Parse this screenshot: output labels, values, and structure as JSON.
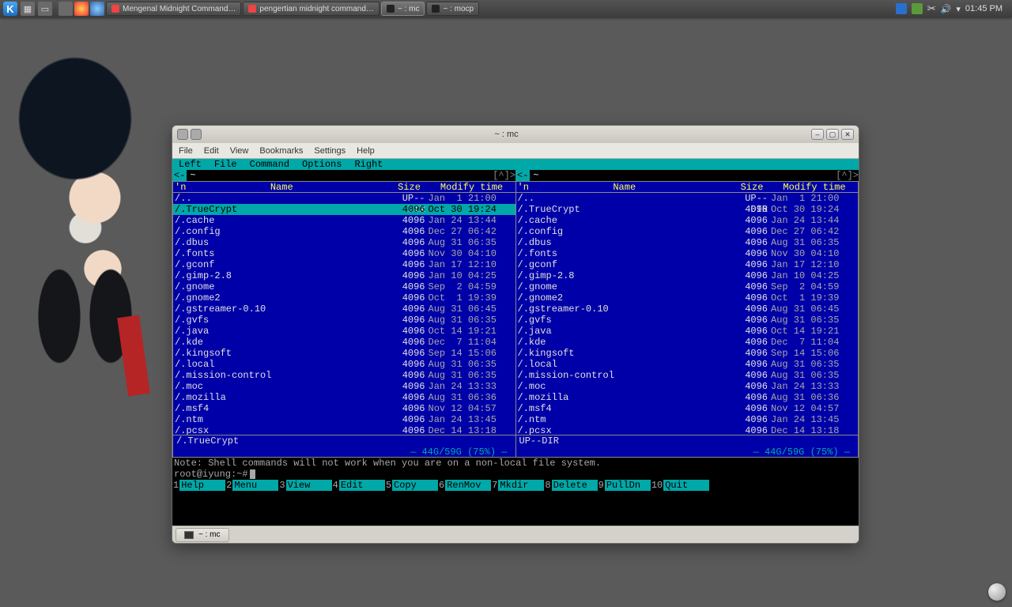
{
  "panel": {
    "tasks": [
      {
        "label": "Mengenal Midnight Command…",
        "icon": "chrome"
      },
      {
        "label": "pengertian midnight command…",
        "icon": "chromium"
      },
      {
        "label": "~ : mc",
        "icon": "terminal",
        "active": true
      },
      {
        "label": "~ : mocp",
        "icon": "terminal"
      }
    ],
    "clock": "01:45 PM"
  },
  "window": {
    "title": "~ : mc",
    "menubar": [
      "File",
      "Edit",
      "View",
      "Bookmarks",
      "Settings",
      "Help"
    ],
    "task_label": "~ : mc"
  },
  "mc": {
    "top_menu": [
      "Left",
      "File",
      "Command",
      "Options",
      "Right"
    ],
    "path_left": "~",
    "path_right": "~",
    "sort_mark": "'n",
    "headers": {
      "name": "Name",
      "size": "Size",
      "mtime": "Modify time"
    },
    "updir_label": "UP--DIR",
    "files": [
      {
        "name": "/..",
        "size": "UP--DIR",
        "mtime": "Jan  1 21:00",
        "updir": true
      },
      {
        "name": "/.TrueCrypt",
        "size": "4096",
        "mtime": "Oct 30 19:24",
        "selected": true
      },
      {
        "name": "/.cache",
        "size": "4096",
        "mtime": "Jan 24 13:44"
      },
      {
        "name": "/.config",
        "size": "4096",
        "mtime": "Dec 27 06:42"
      },
      {
        "name": "/.dbus",
        "size": "4096",
        "mtime": "Aug 31 06:35"
      },
      {
        "name": "/.fonts",
        "size": "4096",
        "mtime": "Nov 30 04:10"
      },
      {
        "name": "/.gconf",
        "size": "4096",
        "mtime": "Jan 17 12:10"
      },
      {
        "name": "/.gimp-2.8",
        "size": "4096",
        "mtime": "Jan 10 04:25"
      },
      {
        "name": "/.gnome",
        "size": "4096",
        "mtime": "Sep  2 04:59"
      },
      {
        "name": "/.gnome2",
        "size": "4096",
        "mtime": "Oct  1 19:39"
      },
      {
        "name": "/.gstreamer-0.10",
        "size": "4096",
        "mtime": "Aug 31 06:45"
      },
      {
        "name": "/.gvfs",
        "size": "4096",
        "mtime": "Aug 31 06:35"
      },
      {
        "name": "/.java",
        "size": "4096",
        "mtime": "Oct 14 19:21"
      },
      {
        "name": "/.kde",
        "size": "4096",
        "mtime": "Dec  7 11:04"
      },
      {
        "name": "/.kingsoft",
        "size": "4096",
        "mtime": "Sep 14 15:06"
      },
      {
        "name": "/.local",
        "size": "4096",
        "mtime": "Aug 31 06:35"
      },
      {
        "name": "/.mission-control",
        "size": "4096",
        "mtime": "Aug 31 06:35"
      },
      {
        "name": "/.moc",
        "size": "4096",
        "mtime": "Jan 24 13:33"
      },
      {
        "name": "/.mozilla",
        "size": "4096",
        "mtime": "Aug 31 06:36"
      },
      {
        "name": "/.msf4",
        "size": "4096",
        "mtime": "Nov 12 04:57"
      },
      {
        "name": "/.ntm",
        "size": "4096",
        "mtime": "Jan 24 13:45"
      },
      {
        "name": "/.pcsx",
        "size": "4096",
        "mtime": "Dec 14 13:18"
      }
    ],
    "hint_left": "/.TrueCrypt",
    "hint_right": "UP--DIR",
    "disk": "44G/59G (75%)",
    "note": "Note: Shell commands will not work when you are on a non-local file system.",
    "prompt": "root@iyung:~#",
    "fkeys": [
      {
        "n": "1",
        "l": "Help"
      },
      {
        "n": "2",
        "l": "Menu"
      },
      {
        "n": "3",
        "l": "View"
      },
      {
        "n": "4",
        "l": "Edit"
      },
      {
        "n": "5",
        "l": "Copy"
      },
      {
        "n": "6",
        "l": "RenMov"
      },
      {
        "n": "7",
        "l": "Mkdir"
      },
      {
        "n": "8",
        "l": "Delete"
      },
      {
        "n": "9",
        "l": "PullDn"
      },
      {
        "n": "10",
        "l": "Quit"
      }
    ]
  }
}
